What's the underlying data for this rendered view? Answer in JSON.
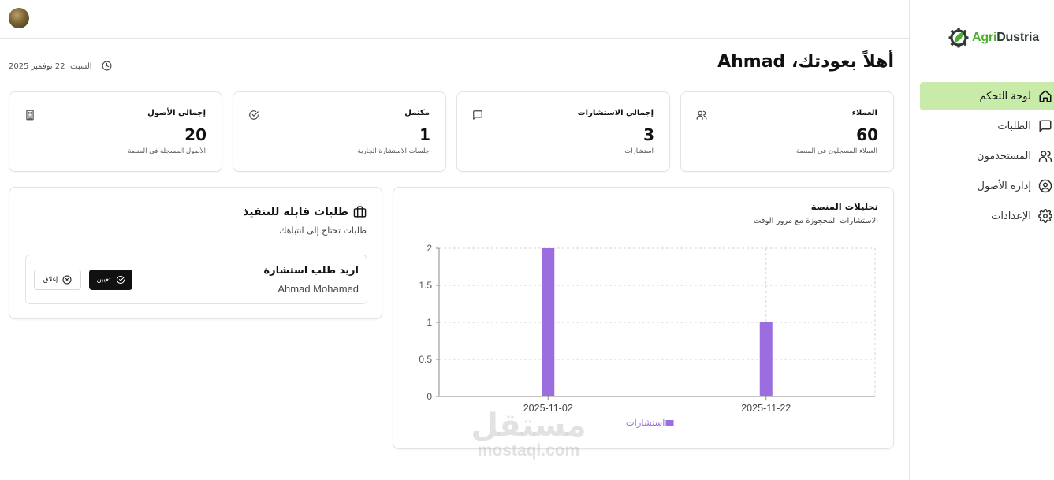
{
  "brand": {
    "name_part1": "Agri",
    "name_part2": "Dustria"
  },
  "sidebar": {
    "items": [
      {
        "label": "لوحة التحكم",
        "icon": "home-icon",
        "active": true
      },
      {
        "label": "الطلبات",
        "icon": "message-square-icon",
        "active": false
      },
      {
        "label": "المستخدمون",
        "icon": "users-icon",
        "active": false
      },
      {
        "label": "إدارة الأصول",
        "icon": "user-circle-icon",
        "active": false
      },
      {
        "label": "الإعدادات",
        "icon": "gear-icon",
        "active": false
      }
    ]
  },
  "header": {
    "greeting": "أهلاً بعودتك، Ahmad",
    "date": "السبت، 22 نوفمبر 2025"
  },
  "stats": [
    {
      "title": "العملاء",
      "value": "60",
      "subtitle": "العملاء المسجلون في المنصة",
      "icon": "users-icon"
    },
    {
      "title": "إجمالي الاستشارات",
      "value": "3",
      "subtitle": "استشارات",
      "icon": "message-square-icon"
    },
    {
      "title": "مكتمل",
      "value": "1",
      "subtitle": "جلسات الاستشارة الجارية",
      "icon": "check-circle-icon"
    },
    {
      "title": "إجمالي الأصول",
      "value": "20",
      "subtitle": "الأصول المسجلة في المنصة",
      "icon": "building-icon"
    }
  ],
  "requests": {
    "title": "طلبات قابلة للتنفيذ",
    "subtitle": "طلبات تحتاج إلى انتباهك",
    "items": [
      {
        "name": "اريد طلب استشارة",
        "person": "Ahmad Mohamed",
        "assign_label": "تعيين",
        "close_label": "إغلاق"
      }
    ]
  },
  "analytics": {
    "title": "تحليلات المنصة",
    "subtitle": "الاستشارات المحجوزة مع مرور الوقت"
  },
  "chart_data": {
    "type": "bar",
    "categories": [
      "2025-11-02",
      "2025-11-22"
    ],
    "series": [
      {
        "name": "استشارات",
        "values": [
          2,
          1
        ]
      }
    ],
    "ylim": [
      0,
      2
    ],
    "yticks": [
      "0",
      "0.5",
      "1",
      "1.5",
      "2"
    ],
    "grid": true,
    "legend": "bottom",
    "bar_color": "#9b6ddf"
  },
  "watermark": {
    "line1": "مستقل",
    "line2": "mostaql.com"
  },
  "colors": {
    "accent": "#c9ebaa",
    "brand_green": "#4caf32"
  }
}
